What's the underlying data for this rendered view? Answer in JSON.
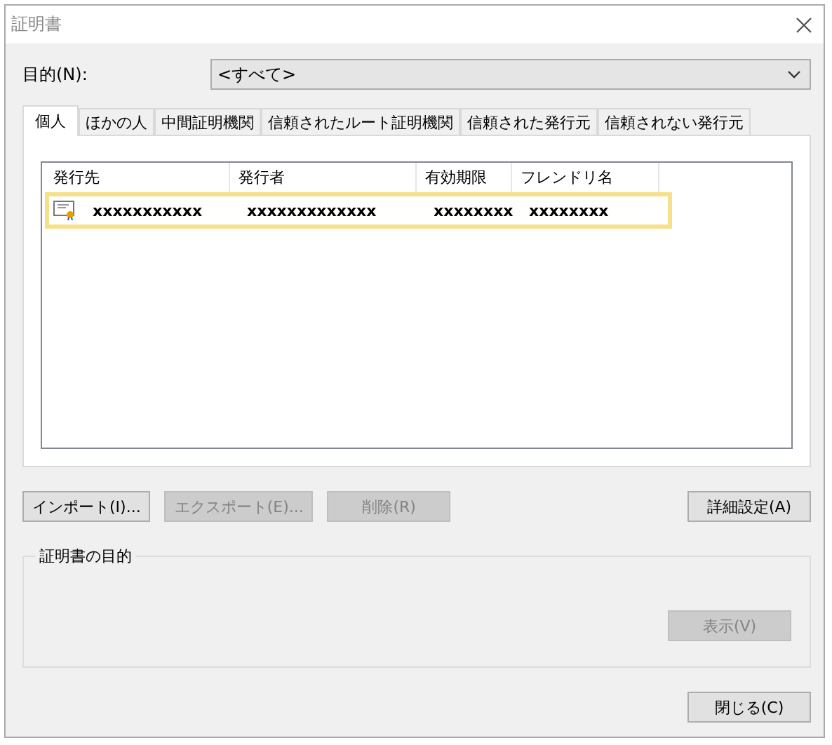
{
  "window": {
    "title": "証明書"
  },
  "purpose": {
    "label": "目的(N):",
    "value": "<すべて>"
  },
  "tabs": [
    {
      "label": "個人",
      "selected": true
    },
    {
      "label": "ほかの人",
      "selected": false
    },
    {
      "label": "中間証明機関",
      "selected": false
    },
    {
      "label": "信頼されたルート証明機関",
      "selected": false
    },
    {
      "label": "信頼された発行元",
      "selected": false
    },
    {
      "label": "信頼されない発行元",
      "selected": false
    }
  ],
  "table": {
    "columns": [
      "発行先",
      "発行者",
      "有効期限",
      "フレンドリ名"
    ],
    "rows": [
      {
        "cells": [
          "xxxxxxxxxxx",
          "xxxxxxxxxxxxx",
          "xxxxxxxx",
          "xxxxxxxx"
        ],
        "selected": true
      }
    ]
  },
  "buttons": [
    {
      "label": "インポート(I)...",
      "disabled": false
    },
    {
      "label": "エクスポート(E)...",
      "disabled": true
    },
    {
      "label": "削除(R)",
      "disabled": true
    },
    {
      "label": "詳細設定(A)",
      "disabled": false
    }
  ],
  "purpose_group": {
    "label": "証明書の目的",
    "button": {
      "label": "表示(V)",
      "disabled": true
    }
  },
  "close_button": {
    "label": "閉じる(C)",
    "disabled": false
  }
}
